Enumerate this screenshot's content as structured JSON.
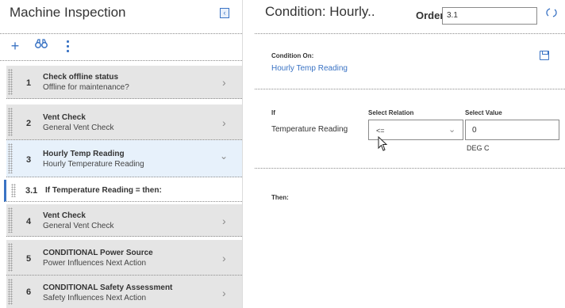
{
  "left_panel": {
    "title": "Machine Inspection",
    "collapse_icon": "chevron-left-box-icon",
    "toolbar": {
      "add_icon": "plus-icon",
      "find_icon": "binoculars-icon",
      "more_icon": "vertical-ellipsis-icon"
    },
    "steps": [
      {
        "number": "1",
        "title": "Check offline status",
        "subtitle": "Offline for maintenance?",
        "expanded": false
      },
      {
        "number": "2",
        "title": "Vent Check",
        "subtitle": "General Vent Check",
        "expanded": false
      },
      {
        "number": "3",
        "title": "Hourly Temp Reading",
        "subtitle": "Hourly Temperature Reading",
        "expanded": true
      },
      {
        "number": "4",
        "title": "Vent Check",
        "subtitle": "General Vent Check",
        "expanded": false
      },
      {
        "number": "5",
        "title": "CONDITIONAL Power Source",
        "subtitle": "Power Influences Next Action",
        "expanded": false
      },
      {
        "number": "6",
        "title": "CONDITIONAL Safety Assessment",
        "subtitle": "Safety Influences Next Action",
        "expanded": false
      }
    ],
    "substep": {
      "number": "3.1",
      "title": "If Temperature Reading = then:"
    }
  },
  "right_panel": {
    "title": "Condition: Hourly..",
    "order_label": "Order",
    "order_value": "3.1",
    "refresh_icon": "refresh-icon",
    "condition_on_label": "Condition On:",
    "condition_on_value": "Hourly Temp Reading",
    "save_icon": "save-icon",
    "if_label": "If",
    "select_relation_header": "Select Relation",
    "select_value_header": "Select Value",
    "field_name": "Temperature Reading",
    "relation_value": "<=",
    "value": "0",
    "unit": "DEG C",
    "then_label": "Then:"
  },
  "colors": {
    "accent": "#3a73c4",
    "step_bg": "#e5e5e5",
    "selected_bg": "#e7f1fb"
  }
}
